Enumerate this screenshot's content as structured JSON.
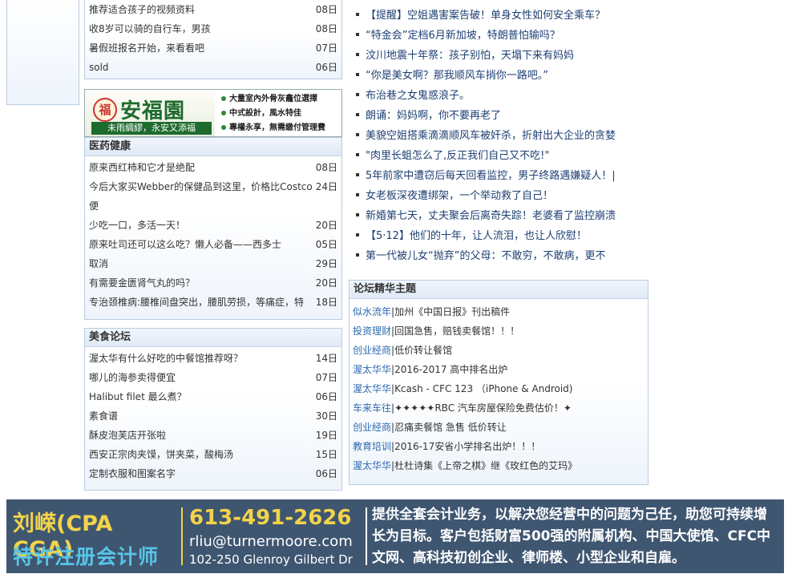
{
  "top_list": [
    {
      "title": "推荐适合孩子的视频资料",
      "date": "08日"
    },
    {
      "title": "收8岁可以骑的自行车，男孩",
      "date": "08日"
    },
    {
      "title": "暑假班报名开始，来看看吧",
      "date": "07日"
    },
    {
      "title": "sold",
      "date": "06日"
    }
  ],
  "ad_banner": {
    "badge": "福",
    "name": "安福園",
    "sub": "未雨綢繆，永安又添福",
    "points": [
      "大量室內外骨灰龕位選擇",
      "中式設計，風水特佳",
      "專權永享，無需繳付管理費"
    ]
  },
  "health": {
    "title": "医药健康",
    "items": [
      {
        "title": "原来西红柿和它才是绝配",
        "date": "08日"
      },
      {
        "title": "今后大家买Webber的保健品到这里，价格比Costco便",
        "date": "24日"
      },
      {
        "title": "少吃一口，多活一天！",
        "date": "20日"
      },
      {
        "title": "原来吐司还可以这么吃？懒人必备——西多士",
        "date": "05日"
      },
      {
        "title": "取消",
        "date": "29日"
      },
      {
        "title": "有需要金匮肾气丸的吗？",
        "date": "20日"
      },
      {
        "title": "专治颈椎病:腰椎间盘突出，腰肌劳损，等痛症，特",
        "date": "18日"
      }
    ]
  },
  "food": {
    "title": "美食论坛",
    "items": [
      {
        "title": "渥太华有什么好吃的中餐馆推荐呀？",
        "date": "14日"
      },
      {
        "title": "哪儿的海参卖得便宜",
        "date": "07日"
      },
      {
        "title": "Halibut filet 最么煮？",
        "date": "06日"
      },
      {
        "title": "素食谱",
        "date": "30日"
      },
      {
        "title": "酥皮泡芙店开张啦",
        "date": "19日"
      },
      {
        "title": "西安正宗肉夹馍，饼夹菜，酸梅汤",
        "date": "15日"
      },
      {
        "title": "定制衣服和图案名字",
        "date": "06日"
      }
    ]
  },
  "news": [
    "【提醒】空姐遇害案告破！单身女性如何安全乘车？",
    "“特金会”定档6月新加坡，特朗普怕输吗？",
    "汶川地震十年祭：孩子别怕，天塌下来有妈妈",
    "“你是美女啊？那我顺风车捎你一路吧。”",
    "布治巷之女鬼惑浪子。",
    "朗诵：妈妈啊，你不要再老了",
    "美貌空姐搭乘滴滴顺风车被奸杀，折射出大企业的贪婪",
    "\"肉里长蛆怎么了,反正我们自己又不吃!\"",
    "5年前家中遭窃后每天回看监控，男子终路遇嫌疑人！|",
    "女老板深夜遭绑架，一个举动救了自己！",
    "新婚第七天，丈夫聚会后离奇失踪！老婆看了监控崩溃",
    "【5·12】他们的十年，让人流泪，也让人欣慰！",
    "第一代被儿女“抛弃”的父母：不敢穷，不敢病，更不"
  ],
  "forum": {
    "title": "论坛精华主题",
    "items": [
      {
        "cat": "似水流年",
        "title": "加州《中国日报》刊出稿件"
      },
      {
        "cat": "投资理财",
        "title": "回国急售，赔钱卖餐馆！！！"
      },
      {
        "cat": "创业经商",
        "title": "低价转让餐馆"
      },
      {
        "cat": "渥太华华",
        "title": "2016-2017 高中排名出炉"
      },
      {
        "cat": "渥太华华",
        "title": "Kcash - CFC 123 （iPhone & Android)"
      },
      {
        "cat": "车来车往",
        "title": "✦✦✦✦✦RBC 汽车房屋保险免费估价！✦"
      },
      {
        "cat": "创业经商",
        "title": "忍痛卖餐馆 急售 低价转让"
      },
      {
        "cat": "教育培训",
        "title": "2016-17安省小学排名出炉！！！"
      },
      {
        "cat": "渥太华华",
        "title": "杜杜诗集《上帝之棋》继《玫红色的艾玛》"
      }
    ]
  },
  "bottom_ad": {
    "name": "刘嵘(CPA CGA)",
    "title": "特许注册会计师",
    "phone": "613-491-2626",
    "email": "rliu@turnermoore.com",
    "address": "102-250 Glenroy Gilbert Dr",
    "desc": "提供全套会计业务，以解决您经营中的问题为己任，助您可持续增长为目标。客户包括财富500强的附属机构、中国大使馆、CFC中文网、高科技初创企业、律师楼、小型企业和自雇。"
  }
}
